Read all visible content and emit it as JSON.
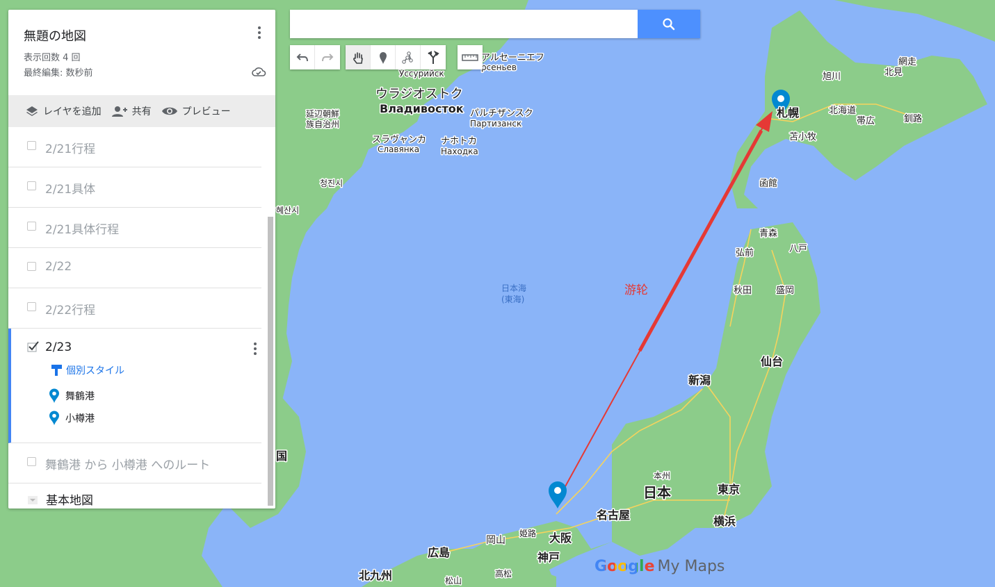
{
  "panel": {
    "title": "無題の地図",
    "view_count": "表示回数 4 回",
    "last_edit": "最終編集: 数秒前",
    "actions": {
      "add_layer": "レイヤを追加",
      "share": "共有",
      "preview": "プレビュー"
    },
    "layers": [
      {
        "label": "2/21行程",
        "checked": false
      },
      {
        "label": "2/21具体",
        "checked": false
      },
      {
        "label": "2/21具体行程",
        "checked": false
      },
      {
        "label": "2/22",
        "checked": false
      },
      {
        "label": "2/22行程",
        "checked": false
      }
    ],
    "active_layer": {
      "label": "2/23",
      "checked": true,
      "style_link": "個別スタイル",
      "places": [
        "舞鶴港",
        "小樽港"
      ]
    },
    "route_layer": {
      "label": "舞鶴港 から 小樽港 へのルート",
      "checked": false
    },
    "basemap": "基本地図"
  },
  "search": {
    "value": "",
    "placeholder": ""
  },
  "toolbar": {
    "tools": [
      "undo-icon",
      "redo-icon",
      "hand-icon",
      "marker-icon",
      "line-icon",
      "directions-icon",
      "ruler-icon"
    ]
  },
  "map": {
    "annotation": "游轮",
    "labels": {
      "vladivostok_ja": "ウラジオストク",
      "vladivostok_ru": "Владивосток",
      "sea_of_japan_1": "日本海",
      "sea_of_japan_2": "(東海)",
      "japan": "日本",
      "tokyo": "東京",
      "yokohama": "横浜",
      "osaka": "大阪",
      "kobe": "神戸",
      "nagoya": "名古屋",
      "sendai": "仙台",
      "niigata": "新潟",
      "hiroshima": "広島",
      "sapporo": "札幌",
      "hakodate": "函館",
      "aomori": "青森",
      "akita": "秋田",
      "morioka": "盛岡",
      "asahikawa": "旭川",
      "kushiro": "釧路",
      "obihiro": "帯広",
      "kitakyushu": "北九州",
      "partizansk_ja": "パルチザンスク",
      "partizansk_ru": "Партизанск",
      "nakhodka_ja": "ナホトカ",
      "nakhodka_ru": "Находка",
      "slavyanka_ja": "スラヴャンカ",
      "slavyanka_ru": "Славянка",
      "ussuriysk": "Уссурийск",
      "arsenyev_ja": "アルセーニエフ",
      "arsenyev_ru": "рсеньев",
      "yanbian1": "延辺朝鮮",
      "yanbian2": "族自治州",
      "chongjin": "청진시",
      "hamhung": "혜산시",
      "hokkaido": "北海道",
      "abashiri": "網走",
      "kitami": "北見",
      "tomakomai": "苫小牧",
      "hirosaki": "弘前",
      "hachinohe": "八戸",
      "himeji": "姫路",
      "okayama": "岡山",
      "takamatsu": "高松",
      "matsuyama": "松山",
      "honshu": "本州",
      "korea": "国"
    },
    "brand_google": "Google",
    "brand_mymaps": "My Maps"
  },
  "colors": {
    "water": "#8ab4f8",
    "land": "#8ccc8a",
    "marker": "#0288d1",
    "route": "#e53935",
    "accent": "#4285f4"
  }
}
